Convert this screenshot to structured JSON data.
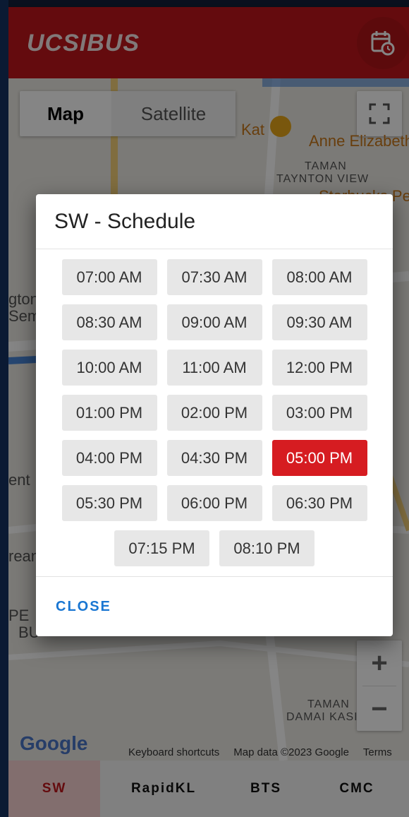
{
  "app": {
    "logo": "UCSIBUS"
  },
  "icons": {
    "calendar": "calendar-clock-icon",
    "fullscreen": "fullscreen-icon",
    "zoom_in": "plus-icon",
    "zoom_out": "minus-icon",
    "cafe": "cafe-pin-icon"
  },
  "map": {
    "type_map": "Map",
    "type_satellite": "Satellite",
    "labels": {
      "kat": "Kat",
      "anne": "Anne Elizabeth",
      "taman1": "TAMAN",
      "taynton": "TAYNTON VIEW",
      "starbucks": "Starbucks Pe",
      "taman2": "TAMAN",
      "damai": "DAMAI KASI",
      "ent": "ent",
      "rean": "rean",
      "pe": "PE",
      "bu": "BU",
      "ton": "gton",
      "em": "Sem"
    },
    "zoom_in": "+",
    "zoom_out": "−",
    "google": "Google",
    "attrib": {
      "shortcuts": "Keyboard shortcuts",
      "data": "Map data ©2023 Google",
      "terms": "Terms"
    }
  },
  "dialog": {
    "title": "SW - Schedule",
    "times": [
      [
        "07:00 AM",
        "07:30 AM",
        "08:00 AM"
      ],
      [
        "08:30 AM",
        "09:00 AM",
        "09:30 AM"
      ],
      [
        "10:00 AM",
        "11:00 AM",
        "12:00 PM"
      ],
      [
        "01:00 PM",
        "02:00 PM",
        "03:00 PM"
      ],
      [
        "04:00 PM",
        "04:30 PM",
        "05:00 PM"
      ],
      [
        "05:30 PM",
        "06:00 PM",
        "06:30 PM"
      ],
      [
        "07:15 PM",
        "08:10 PM"
      ]
    ],
    "active_time": "05:00 PM",
    "close_label": "CLOSE"
  },
  "nav": {
    "tabs": [
      "SW",
      "RapidKL",
      "BTS",
      "CMC"
    ],
    "active": "SW"
  },
  "colors": {
    "brand": "#c0161b",
    "active": "#d61c21",
    "link": "#1976d2"
  }
}
